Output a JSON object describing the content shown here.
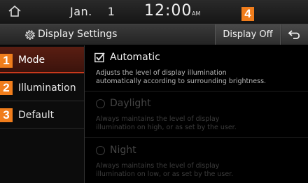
{
  "status_bar": {
    "month": "Jan.",
    "day": "1",
    "time": "12:00",
    "ampm": "AM"
  },
  "title_bar": {
    "title": "Display Settings",
    "display_off_label": "Display Off"
  },
  "callouts": [
    "1",
    "2",
    "3",
    "4"
  ],
  "sidebar": {
    "items": [
      {
        "label": "Mode",
        "active": true
      },
      {
        "label": "Illumination",
        "active": false
      },
      {
        "label": "Default",
        "active": false
      }
    ]
  },
  "options": [
    {
      "label": "Automatic",
      "checked": true,
      "enabled": true,
      "desc1": "Adjusts the level of display illumination",
      "desc2": "automatically according to surrounding brightness."
    },
    {
      "label": "Daylight",
      "checked": false,
      "enabled": false,
      "desc1": "Always maintains the level of display",
      "desc2": "illumination on high, or as set by the user."
    },
    {
      "label": "Night",
      "checked": false,
      "enabled": false,
      "desc1": "Always maintains the level of display",
      "desc2": "illumination on low, or as set by the user."
    }
  ],
  "colors": {
    "accent_red": "#c9391c",
    "badge_orange": "#f07d1c"
  }
}
